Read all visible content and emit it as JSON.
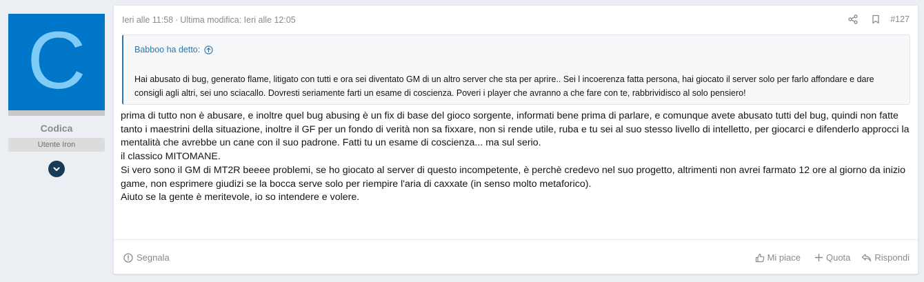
{
  "user": {
    "avatar_letter": "C",
    "name": "Codica",
    "title": "Utente Iron",
    "avatar_bg": "#0076c8",
    "avatar_fg": "#7fcdf6"
  },
  "post": {
    "posted": "Ieri alle 11:58",
    "separator": "·",
    "edited": "Ultima modifica: Ieri alle 12:05",
    "number": "#127",
    "quote": {
      "author": "Babboo ha detto:",
      "text": "Hai abusato di bug, generato flame, litigato con tutti e ora sei diventato GM di un altro server che sta per aprire.. Sei l incoerenza fatta persona, hai giocato il server solo per farlo affondare e dare consigli agli altri, sei uno sciacallo. Dovresti seriamente farti un esame di coscienza. Poveri i player che avranno a che fare con te, rabbrividisco al solo pensiero!"
    },
    "message": [
      "prima di tutto non è abusare, e inoltre quel bug abusing è un fix di base del gioco sorgente, informati bene prima di parlare, e comunque avete abusato tutti del bug, quindi non fatte tanto i maestrini della situazione, inoltre il GF per un fondo di verità non sa fixxare, non si rende utile, ruba e tu sei al suo stesso livello di intelletto, per giocarci e difenderlo approcci la mentalità che avrebbe un cane con il suo padrone. Fatti tu un esame di coscienza... ma sul serio.",
      "il classico MITOMANE.",
      "Si vero sono il GM di MT2R beeee problemi, se ho giocato al server di questo incompetente, è perchè credevo nel suo progetto, altrimenti non avrei farmato 12 ore al giorno da inizio game, non esprimere giudizi se la bocca serve solo per riempire l'aria di caxxate (in senso molto metaforico).",
      "Aiuto se la gente è meritevole, io so intendere e volere."
    ]
  },
  "actions": {
    "report": "Segnala",
    "like": "Mi piace",
    "quote": "Quota",
    "reply": "Rispondi"
  },
  "colors": {
    "accent": "#2577b1",
    "muted": "#8a8a8a",
    "expand_button": "#163b57"
  }
}
